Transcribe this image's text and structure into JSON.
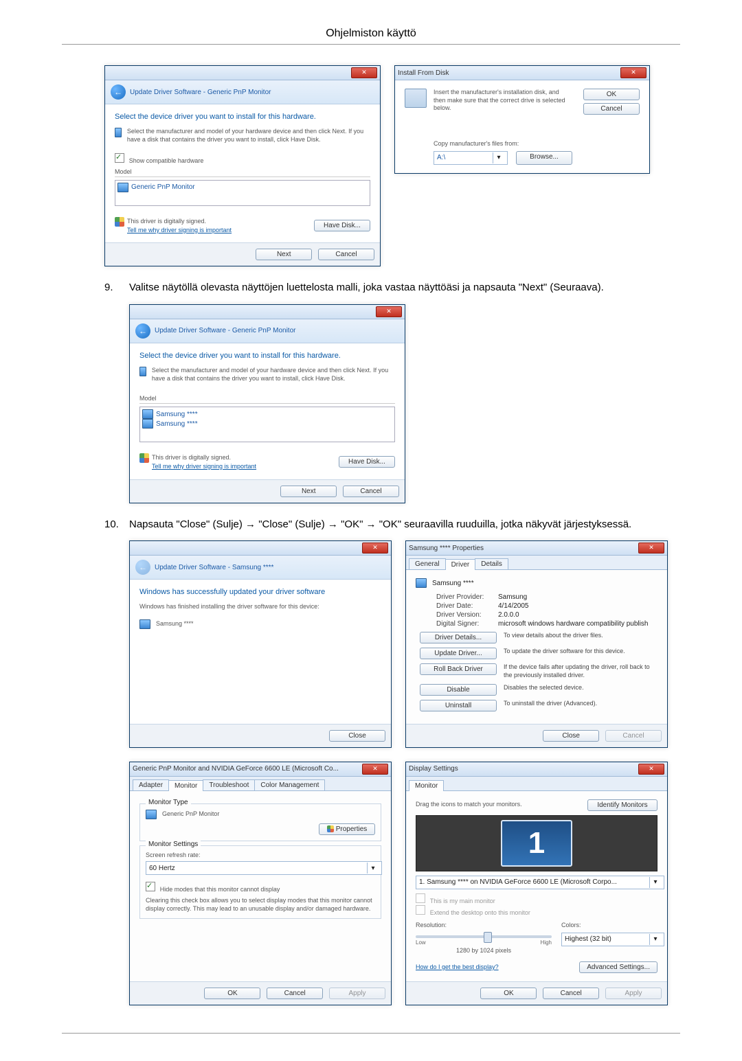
{
  "page_header": "Ohjelmiston käyttö",
  "steps": {
    "s9": {
      "num": "9.",
      "text": "Valitse näytöllä olevasta näyttöjen luettelosta malli, joka vastaa näyttöäsi ja napsauta \"Next\" (Seuraava)."
    },
    "s10": {
      "num": "10.",
      "text": "Napsauta \"Close\" (Sulje) → \"Close\" (Sulje) → \"OK\" → \"OK\" seuraavilla ruuduilla, jotka näkyvät järjestyksessä."
    }
  },
  "win_select_driver_1": {
    "breadcrumb": "Update Driver Software - Generic PnP Monitor",
    "heading": "Select the device driver you want to install for this hardware.",
    "desc": "Select the manufacturer and model of your hardware device and then click Next. If you have a disk that contains the driver you want to install, click Have Disk.",
    "check_label": "Show compatible hardware",
    "model_header": "Model",
    "model_item": "Generic PnP Monitor",
    "signed": "This driver is digitally signed.",
    "signed_link": "Tell me why driver signing is important",
    "have_disk": "Have Disk...",
    "next": "Next",
    "cancel": "Cancel"
  },
  "win_install_from_disk": {
    "title": "Install From Disk",
    "desc": "Insert the manufacturer's installation disk, and then make sure that the correct drive is selected below.",
    "ok": "OK",
    "cancel": "Cancel",
    "copy_label": "Copy manufacturer's files from:",
    "path": "A:\\",
    "browse": "Browse..."
  },
  "win_select_driver_2": {
    "breadcrumb": "Update Driver Software - Generic PnP Monitor",
    "heading": "Select the device driver you want to install for this hardware.",
    "desc": "Select the manufacturer and model of your hardware device and then click Next. If you have a disk that contains the driver you want to install, click Have Disk.",
    "model_header": "Model",
    "model_items": [
      "Samsung ****",
      "Samsung ****"
    ],
    "signed": "This driver is digitally signed.",
    "signed_link": "Tell me why driver signing is important",
    "have_disk": "Have Disk...",
    "next": "Next",
    "cancel": "Cancel"
  },
  "win_success": {
    "breadcrumb": "Update Driver Software - Samsung ****",
    "heading": "Windows has successfully updated your driver software",
    "desc": "Windows has finished installing the driver software for this device:",
    "device": "Samsung ****",
    "close": "Close"
  },
  "win_properties": {
    "title": "Samsung **** Properties",
    "tabs": [
      "General",
      "Driver",
      "Details"
    ],
    "device": "Samsung ****",
    "kv_provider": {
      "k": "Driver Provider:",
      "v": "Samsung"
    },
    "kv_date": {
      "k": "Driver Date:",
      "v": "4/14/2005"
    },
    "kv_version": {
      "k": "Driver Version:",
      "v": "2.0.0.0"
    },
    "kv_signer": {
      "k": "Digital Signer:",
      "v": "microsoft windows hardware compatibility publish"
    },
    "btns": {
      "details": {
        "l": "Driver Details...",
        "d": "To view details about the driver files."
      },
      "update": {
        "l": "Update Driver...",
        "d": "To update the driver software for this device."
      },
      "rollback": {
        "l": "Roll Back Driver",
        "d": "If the device fails after updating the driver, roll back to the previously installed driver."
      },
      "disable": {
        "l": "Disable",
        "d": "Disables the selected device."
      },
      "uninstall": {
        "l": "Uninstall",
        "d": "To uninstall the driver (Advanced)."
      }
    },
    "close": "Close",
    "cancel": "Cancel"
  },
  "win_monitor_tab": {
    "title": "Generic PnP Monitor and NVIDIA GeForce 6600 LE (Microsoft Co...",
    "tabs": [
      "Adapter",
      "Monitor",
      "Troubleshoot",
      "Color Management"
    ],
    "group_type": "Monitor Type",
    "monitor_type": "Generic PnP Monitor",
    "properties_btn": "Properties",
    "group_settings": "Monitor Settings",
    "refresh_label": "Screen refresh rate:",
    "refresh_value": "60 Hertz",
    "hide_label": "Hide modes that this monitor cannot display",
    "hide_desc": "Clearing this check box allows you to select display modes that this monitor cannot display correctly. This may lead to an unusable display and/or damaged hardware.",
    "ok": "OK",
    "cancel": "Cancel",
    "apply": "Apply"
  },
  "win_display_settings": {
    "title": "Display Settings",
    "tab": "Monitor",
    "drag_label": "Drag the icons to match your monitors.",
    "identify": "Identify Monitors",
    "monitor_num": "1",
    "monitor_combo": "1. Samsung **** on NVIDIA GeForce 6600 LE (Microsoft Corpo...",
    "main_check": "This is my main monitor",
    "extend_check": "Extend the desktop onto this monitor",
    "res_label": "Resolution:",
    "res_low": "Low",
    "res_high": "High",
    "res_value": "1280 by 1024 pixels",
    "colors_label": "Colors:",
    "colors_value": "Highest (32 bit)",
    "best_link": "How do I get the best display?",
    "advanced": "Advanced Settings...",
    "ok": "OK",
    "cancel": "Cancel",
    "apply": "Apply"
  }
}
